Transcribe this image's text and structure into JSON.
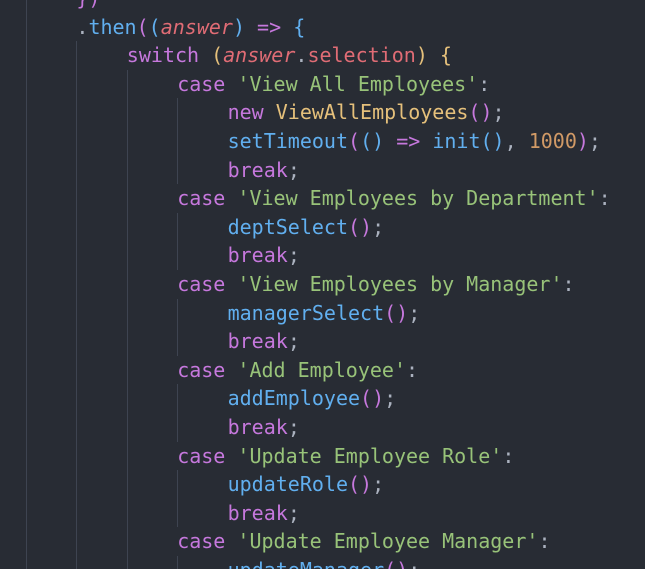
{
  "lines": [
    {
      "indent": 1,
      "tokens": [
        {
          "t": "})",
          "c": "p2"
        }
      ]
    },
    {
      "indent": 1,
      "tokens": [
        {
          "t": ".",
          "c": "plain"
        },
        {
          "t": "then",
          "c": "fn"
        },
        {
          "t": "(",
          "c": "p2"
        },
        {
          "t": "(",
          "c": "p3"
        },
        {
          "t": "answer",
          "c": "param"
        },
        {
          "t": ")",
          "c": "p3"
        },
        {
          "t": " ",
          "c": "plain"
        },
        {
          "t": "=>",
          "c": "kw"
        },
        {
          "t": " ",
          "c": "plain"
        },
        {
          "t": "{",
          "c": "p3"
        }
      ]
    },
    {
      "indent": 2,
      "tokens": [
        {
          "t": "switch",
          "c": "kw"
        },
        {
          "t": " ",
          "c": "plain"
        },
        {
          "t": "(",
          "c": "p1"
        },
        {
          "t": "answer",
          "c": "param"
        },
        {
          "t": ".",
          "c": "plain"
        },
        {
          "t": "selection",
          "c": "prop"
        },
        {
          "t": ")",
          "c": "p1"
        },
        {
          "t": " ",
          "c": "plain"
        },
        {
          "t": "{",
          "c": "p1"
        }
      ]
    },
    {
      "indent": 3,
      "tokens": [
        {
          "t": "case",
          "c": "kw"
        },
        {
          "t": " ",
          "c": "plain"
        },
        {
          "t": "'View All Employees'",
          "c": "str"
        },
        {
          "t": ":",
          "c": "plain"
        }
      ]
    },
    {
      "indent": 4,
      "tokens": [
        {
          "t": "new",
          "c": "kw"
        },
        {
          "t": " ",
          "c": "plain"
        },
        {
          "t": "ViewAllEmployees",
          "c": "cls"
        },
        {
          "t": "()",
          "c": "p2"
        },
        {
          "t": ";",
          "c": "plain"
        }
      ]
    },
    {
      "indent": 4,
      "tokens": [
        {
          "t": "setTimeout",
          "c": "fn"
        },
        {
          "t": "(",
          "c": "p2"
        },
        {
          "t": "()",
          "c": "p3"
        },
        {
          "t": " ",
          "c": "plain"
        },
        {
          "t": "=>",
          "c": "kw"
        },
        {
          "t": " ",
          "c": "plain"
        },
        {
          "t": "init",
          "c": "fn"
        },
        {
          "t": "()",
          "c": "p3"
        },
        {
          "t": ", ",
          "c": "plain"
        },
        {
          "t": "1000",
          "c": "num"
        },
        {
          "t": ")",
          "c": "p2"
        },
        {
          "t": ";",
          "c": "plain"
        }
      ]
    },
    {
      "indent": 4,
      "tokens": [
        {
          "t": "break",
          "c": "kw"
        },
        {
          "t": ";",
          "c": "plain"
        }
      ]
    },
    {
      "indent": 3,
      "tokens": [
        {
          "t": "case",
          "c": "kw"
        },
        {
          "t": " ",
          "c": "plain"
        },
        {
          "t": "'View Employees by Department'",
          "c": "str"
        },
        {
          "t": ":",
          "c": "plain"
        }
      ]
    },
    {
      "indent": 4,
      "tokens": [
        {
          "t": "deptSelect",
          "c": "fn"
        },
        {
          "t": "()",
          "c": "p2"
        },
        {
          "t": ";",
          "c": "plain"
        }
      ]
    },
    {
      "indent": 4,
      "tokens": [
        {
          "t": "break",
          "c": "kw"
        },
        {
          "t": ";",
          "c": "plain"
        }
      ]
    },
    {
      "indent": 3,
      "tokens": [
        {
          "t": "case",
          "c": "kw"
        },
        {
          "t": " ",
          "c": "plain"
        },
        {
          "t": "'View Employees by Manager'",
          "c": "str"
        },
        {
          "t": ":",
          "c": "plain"
        }
      ]
    },
    {
      "indent": 4,
      "tokens": [
        {
          "t": "managerSelect",
          "c": "fn"
        },
        {
          "t": "()",
          "c": "p2"
        },
        {
          "t": ";",
          "c": "plain"
        }
      ]
    },
    {
      "indent": 4,
      "tokens": [
        {
          "t": "break",
          "c": "kw"
        },
        {
          "t": ";",
          "c": "plain"
        }
      ]
    },
    {
      "indent": 3,
      "tokens": [
        {
          "t": "case",
          "c": "kw"
        },
        {
          "t": " ",
          "c": "plain"
        },
        {
          "t": "'Add Employee'",
          "c": "str"
        },
        {
          "t": ":",
          "c": "plain"
        }
      ]
    },
    {
      "indent": 4,
      "tokens": [
        {
          "t": "addEmployee",
          "c": "fn"
        },
        {
          "t": "()",
          "c": "p2"
        },
        {
          "t": ";",
          "c": "plain"
        }
      ]
    },
    {
      "indent": 4,
      "tokens": [
        {
          "t": "break",
          "c": "kw"
        },
        {
          "t": ";",
          "c": "plain"
        }
      ]
    },
    {
      "indent": 3,
      "tokens": [
        {
          "t": "case",
          "c": "kw"
        },
        {
          "t": " ",
          "c": "plain"
        },
        {
          "t": "'Update Employee Role'",
          "c": "str"
        },
        {
          "t": ":",
          "c": "plain"
        }
      ]
    },
    {
      "indent": 4,
      "tokens": [
        {
          "t": "updateRole",
          "c": "fn"
        },
        {
          "t": "()",
          "c": "p2"
        },
        {
          "t": ";",
          "c": "plain"
        }
      ]
    },
    {
      "indent": 4,
      "tokens": [
        {
          "t": "break",
          "c": "kw"
        },
        {
          "t": ";",
          "c": "plain"
        }
      ]
    },
    {
      "indent": 3,
      "tokens": [
        {
          "t": "case",
          "c": "kw"
        },
        {
          "t": " ",
          "c": "plain"
        },
        {
          "t": "'Update Employee Manager'",
          "c": "str"
        },
        {
          "t": ":",
          "c": "plain"
        }
      ]
    },
    {
      "indent": 4,
      "tokens": [
        {
          "t": "updateManager",
          "c": "fn"
        },
        {
          "t": "()",
          "c": "p2"
        },
        {
          "t": ";",
          "c": "plain"
        }
      ]
    }
  ],
  "colors": {
    "background": "#282c34",
    "keyword": "#c678dd",
    "function": "#61afef",
    "string": "#98c379",
    "number": "#d19a66",
    "parameter": "#e06c75",
    "class": "#e5c07b",
    "text": "#abb2bf",
    "indent_guide": "#3e4451"
  }
}
